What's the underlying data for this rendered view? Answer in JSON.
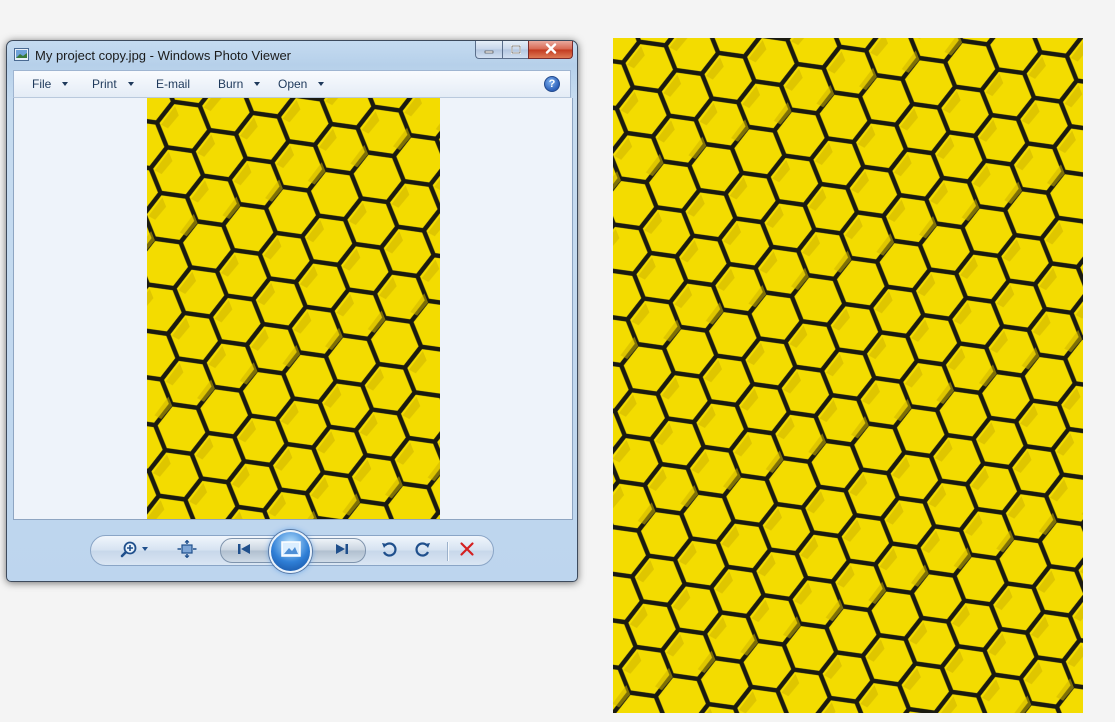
{
  "window": {
    "title": "My project copy.jpg - Windows Photo Viewer",
    "icon": "photo-viewer-app-icon"
  },
  "caption_buttons": {
    "minimize_icon": "minimize-icon",
    "maximize_icon": "maximize-icon",
    "close_icon": "close-icon"
  },
  "menu": {
    "items": [
      {
        "label": "File",
        "has_dropdown": true
      },
      {
        "label": "Print",
        "has_dropdown": true
      },
      {
        "label": "E-mail",
        "has_dropdown": false
      },
      {
        "label": "Burn",
        "has_dropdown": true
      },
      {
        "label": "Open",
        "has_dropdown": true
      }
    ],
    "help_label": "?"
  },
  "controls": {
    "zoom_icon": "magnifier-plus-icon",
    "fit_icon": "actual-size-icon",
    "previous_icon": "skip-previous-icon",
    "slideshow_icon": "slideshow-icon",
    "next_icon": "skip-next-icon",
    "rotate_ccw_icon": "rotate-counterclockwise-icon",
    "rotate_cw_icon": "rotate-clockwise-icon",
    "delete_icon": "delete-x-icon"
  },
  "colors": {
    "honeycomb_yellow": "#f7e300",
    "honeycomb_shadow": "#c9b400",
    "honeycomb_line": "#1a1a10",
    "delete_red": "#d42020",
    "accent_blue": "#2f7fd6"
  }
}
